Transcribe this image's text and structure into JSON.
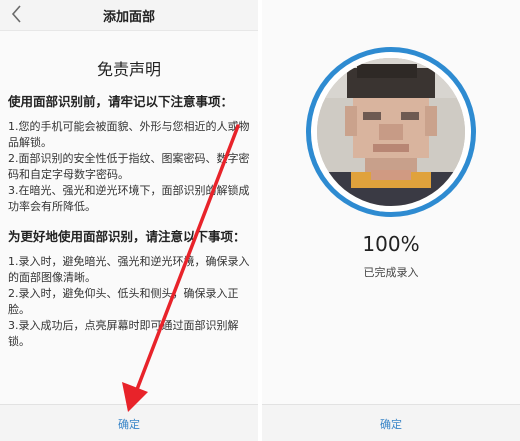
{
  "left": {
    "back_icon": "chevron-left-icon",
    "title": "添加面部",
    "disclaimer_title": "免责声明",
    "section1_head": "使用面部识别前，请牢记以下注意事项：",
    "section1_items": [
      "1.您的手机可能会被面貌、外形与您相近的人或物品解锁。",
      "2.面部识别的安全性低于指纹、图案密码、数字密码和自定字母数字密码。",
      "3.在暗光、强光和逆光环境下，面部识别的解锁成功率会有所降低。"
    ],
    "section2_head": "为更好地使用面部识别，请注意以下事项：",
    "section2_items": [
      "1.录入时，避免暗光、强光和逆光环境，确保录入的面部图像清晰。",
      "2.录入时，避免仰头、低头和侧头，确保录入正脸。",
      "3.录入成功后，点亮屏幕时即可通过面部识别解锁。"
    ],
    "confirm_label": "确定"
  },
  "right": {
    "progress_percent_text": "100%",
    "progress_fraction": 1.0,
    "status_text": "已完成录入",
    "confirm_label": "确定"
  },
  "colors": {
    "accent": "#3a86c8",
    "ring": "#2e8bd1",
    "arrow": "#e8232a"
  }
}
